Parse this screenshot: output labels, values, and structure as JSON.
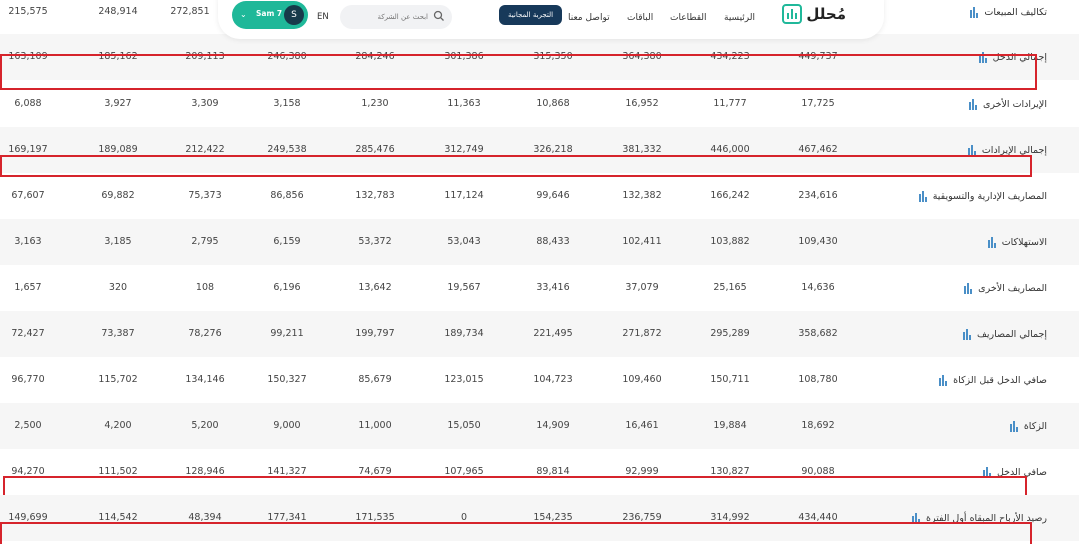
{
  "nav": {
    "logo_text": "مُحلل",
    "links": [
      "الرئيسية",
      "القطاعات",
      "الباقات",
      "تواصل معنا"
    ],
    "active_link": "التجربة المجانية",
    "search_placeholder": "ابحث عن الشركة",
    "language": "EN",
    "user_name": "Sam 7",
    "user_initial": "S"
  },
  "table": {
    "rows": [
      {
        "label": "تكاليف المبيعات",
        "values": [
          "",
          "",
          "",
          "",
          "",
          "",
          "272,851",
          "248,914",
          "215,575"
        ],
        "highlight": false
      },
      {
        "label": "إجمالي الدخل",
        "values": [
          "449,737",
          "434,223",
          "364,380",
          "315,350",
          "301,386",
          "284,246",
          "246,380",
          "209,113",
          "185,162",
          "163,109"
        ],
        "highlight": true
      },
      {
        "label": "الإيرادات الأخرى",
        "values": [
          "17,725",
          "11,777",
          "16,952",
          "10,868",
          "11,363",
          "1,230",
          "3,158",
          "3,309",
          "3,927",
          "6,088"
        ],
        "highlight": false
      },
      {
        "label": "إجمالي الإيرادات",
        "values": [
          "467,462",
          "446,000",
          "381,332",
          "326,218",
          "312,749",
          "285,476",
          "249,538",
          "212,422",
          "189,089",
          "169,197"
        ],
        "highlight": true
      },
      {
        "label": "المصاريف الإدارية والتسويقية",
        "values": [
          "234,616",
          "166,242",
          "132,382",
          "99,646",
          "117,124",
          "132,783",
          "86,856",
          "75,373",
          "69,882",
          "67,607"
        ],
        "highlight": false
      },
      {
        "label": "الاستهلاكات",
        "values": [
          "109,430",
          "103,882",
          "102,411",
          "88,433",
          "53,043",
          "53,372",
          "6,159",
          "2,795",
          "3,185",
          "3,163"
        ],
        "highlight": false
      },
      {
        "label": "المصاريف الأخرى",
        "values": [
          "14,636",
          "25,165",
          "37,079",
          "33,416",
          "19,567",
          "13,642",
          "6,196",
          "108",
          "320",
          "1,657"
        ],
        "highlight": false
      },
      {
        "label": "إجمالي المصاريف",
        "values": [
          "358,682",
          "295,289",
          "271,872",
          "221,495",
          "189,734",
          "199,797",
          "99,211",
          "78,276",
          "73,387",
          "72,427"
        ],
        "highlight": false
      },
      {
        "label": "صافي الدخل قبل الزكاة",
        "values": [
          "108,780",
          "150,711",
          "109,460",
          "104,723",
          "123,015",
          "85,679",
          "150,327",
          "134,146",
          "115,702",
          "96,770"
        ],
        "highlight": false
      },
      {
        "label": "الزكاة",
        "values": [
          "18,692",
          "19,884",
          "16,461",
          "14,909",
          "15,050",
          "11,000",
          "9,000",
          "5,200",
          "4,200",
          "2,500"
        ],
        "highlight": false
      },
      {
        "label": "صافي الدخل",
        "values": [
          "90,088",
          "130,827",
          "92,999",
          "89,814",
          "107,965",
          "74,679",
          "141,327",
          "128,946",
          "111,502",
          "94,270"
        ],
        "highlight": true
      },
      {
        "label": "رصيد الأرباح المبقاه أول الفترة",
        "values": [
          "434,440",
          "314,992",
          "236,759",
          "154,235",
          "0",
          "171,535",
          "177,341",
          "48,394",
          "114,542",
          "149,699"
        ],
        "highlight": true
      }
    ]
  }
}
